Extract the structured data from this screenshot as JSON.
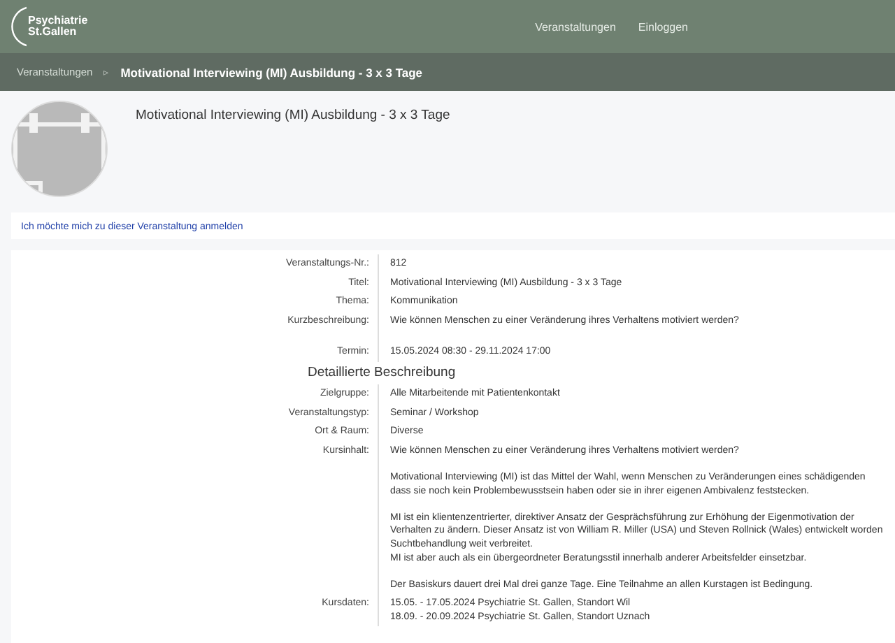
{
  "header": {
    "logo": [
      "Psychiatrie",
      "St.Gallen"
    ],
    "nav": [
      {
        "label": "Veranstaltungen"
      },
      {
        "label": "Einloggen"
      }
    ]
  },
  "breadcrumb": {
    "parent": "Veranstaltungen",
    "separator": "▹",
    "current": "Motivational Interviewing (MI) Ausbildung - 3 x 3 Tage"
  },
  "event": {
    "title": "Motivational Interviewing (MI) Ausbildung - 3 x 3 Tage",
    "register_link": "Ich möchte mich zu dieser Veranstaltung anmelden"
  },
  "details": [
    {
      "kind": "field",
      "label": "Veranstaltungs-Nr.:",
      "paragraphs": [
        [
          "812"
        ]
      ]
    },
    {
      "kind": "field",
      "label": "Titel:",
      "paragraphs": [
        [
          "Motivational Interviewing (MI) Ausbildung - 3 x 3 Tage"
        ]
      ]
    },
    {
      "kind": "field",
      "label": "Thema:",
      "paragraphs": [
        [
          "Kommunikation"
        ]
      ]
    },
    {
      "kind": "field",
      "label": "Kurzbeschreibung:",
      "paragraphs": [
        [
          "Wie können Menschen zu einer Veränderung ihres Verhaltens motiviert werden?"
        ]
      ]
    },
    {
      "kind": "spacer"
    },
    {
      "kind": "field",
      "label": "Termin:",
      "paragraphs": [
        [
          "15.05.2024 08:30 - 29.11.2024 17:00"
        ]
      ]
    },
    {
      "kind": "heading",
      "label": "Detaillierte Beschreibung"
    },
    {
      "kind": "field",
      "label": "Zielgruppe:",
      "paragraphs": [
        [
          "Alle Mitarbeitende mit Patientenkontakt"
        ]
      ]
    },
    {
      "kind": "field",
      "label": "Veranstaltungstyp:",
      "paragraphs": [
        [
          "Seminar / Workshop"
        ]
      ]
    },
    {
      "kind": "field",
      "label": "Ort & Raum:",
      "paragraphs": [
        [
          "Diverse"
        ]
      ]
    },
    {
      "kind": "field",
      "label": "Kursinhalt:",
      "paragraphs": [
        [
          "Wie können Menschen zu einer Veränderung ihres Verhaltens motiviert werden?"
        ],
        [
          "Motivational Interviewing (MI) ist das Mittel der Wahl, wenn Menschen zu Veränderungen eines schädigenden",
          "dass sie noch kein Problembewusstsein haben oder sie in ihrer eigenen Ambivalenz feststecken."
        ],
        [
          "MI ist ein klientenzentrierter, direktiver Ansatz der Gesprächsführung zur Erhöhung der Eigenmotivation der",
          "Verhalten zu ändern. Dieser Ansatz ist von William R. Miller (USA) und Steven Rollnick (Wales) entwickelt worden",
          "Suchtbehandlung weit verbreitet.",
          "MI ist aber auch als ein übergeordneter Beratungsstil innerhalb anderer Arbeitsfelder einsetzbar."
        ],
        [
          "Der Basiskurs dauert drei Mal drei ganze Tage. Eine Teilnahme an allen Kurstagen ist Bedingung."
        ]
      ]
    },
    {
      "kind": "field",
      "label": "Kursdaten:",
      "paragraphs": [
        [
          "15.05. - 17.05.2024 Psychiatrie St. Gallen, Standort Wil",
          "18.09. - 20.09.2024 Psychiatrie St. Gallen, Standort Uznach"
        ]
      ]
    }
  ]
}
